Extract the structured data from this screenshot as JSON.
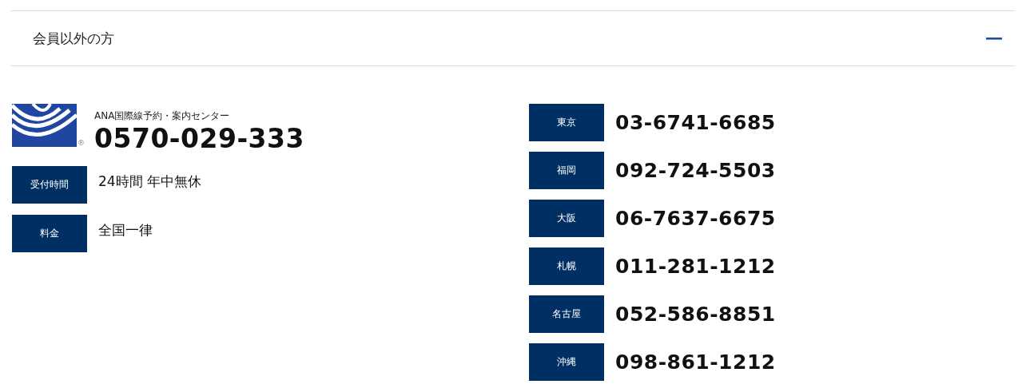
{
  "accordion": {
    "title": "会員以外の方",
    "expanded": true
  },
  "center": {
    "logo_mark": "®",
    "name": "ANA国際線予約・案内センター",
    "phone": "0570-029-333",
    "info": [
      {
        "label": "受付時間",
        "value": "24時間 年中無休"
      },
      {
        "label": "料金",
        "value": "全国一律"
      }
    ]
  },
  "offices": [
    {
      "city": "東京",
      "phone": "03-6741-6685"
    },
    {
      "city": "福岡",
      "phone": "092-724-5503"
    },
    {
      "city": "大阪",
      "phone": "06-7637-6675"
    },
    {
      "city": "札幌",
      "phone": "011-281-1212"
    },
    {
      "city": "名古屋",
      "phone": "052-586-8851"
    },
    {
      "city": "沖縄",
      "phone": "098-861-1212"
    }
  ]
}
